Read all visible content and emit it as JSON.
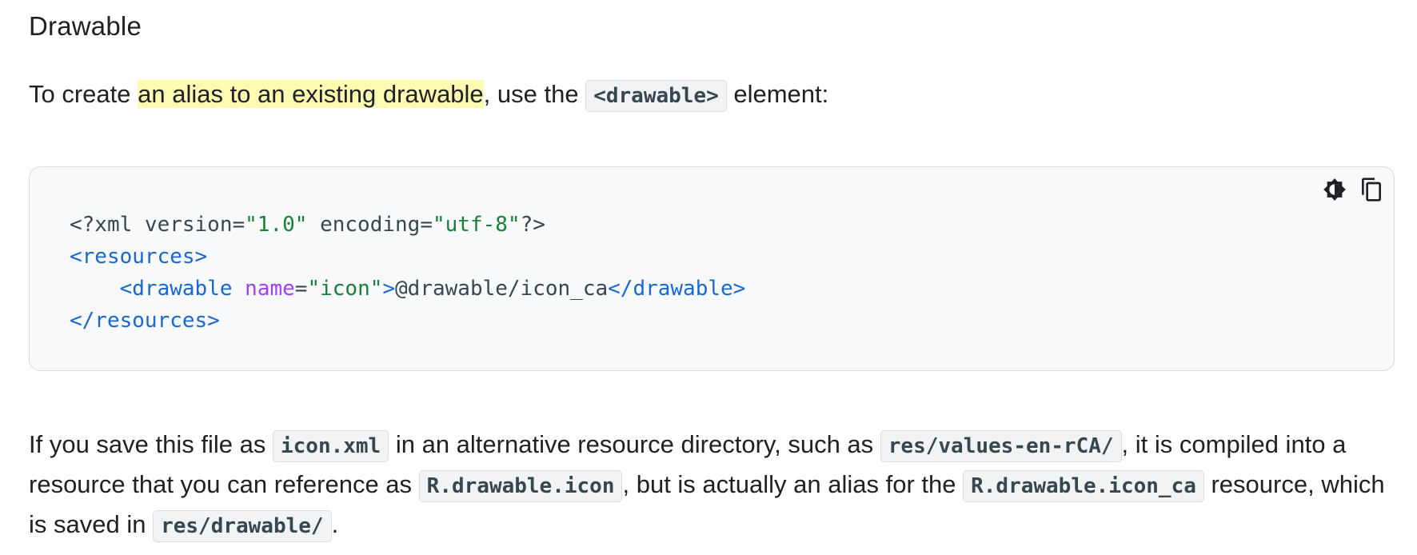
{
  "heading": "Drawable",
  "intro": {
    "before": "To create ",
    "link": "an alias to an existing drawable",
    "middle": ", use the ",
    "code": "<drawable>",
    "after": " element:"
  },
  "code_block": {
    "line1_a": "<?xml version=",
    "line1_b": "\"1.0\"",
    "line1_c": " encoding=",
    "line1_d": "\"utf-8\"",
    "line1_e": "?>",
    "line2": "<resources>",
    "line3_indent": "    ",
    "line3_open": "<drawable",
    "line3_attr": " name",
    "line3_eq": "=",
    "line3_val": "\"icon\"",
    "line3_close": ">",
    "line3_text": "@drawable/icon_ca",
    "line3_end": "</drawable>",
    "line4": "</resources>",
    "icons": [
      "theme-toggle-icon",
      "copy-icon"
    ]
  },
  "outro": {
    "t1": "If you save this file as ",
    "c1": "icon.xml",
    "t2": " in an alternative resource directory, such as ",
    "c2": "res/values-en-rCA/",
    "t3": ", it is compiled into a resource that you can reference as ",
    "c3": "R.drawable.icon",
    "t4": ", but is actually an alias for the ",
    "c4": "R.drawable.icon_ca",
    "t5": " resource, which is saved in ",
    "c5": "res/drawable/",
    "t6": "."
  }
}
